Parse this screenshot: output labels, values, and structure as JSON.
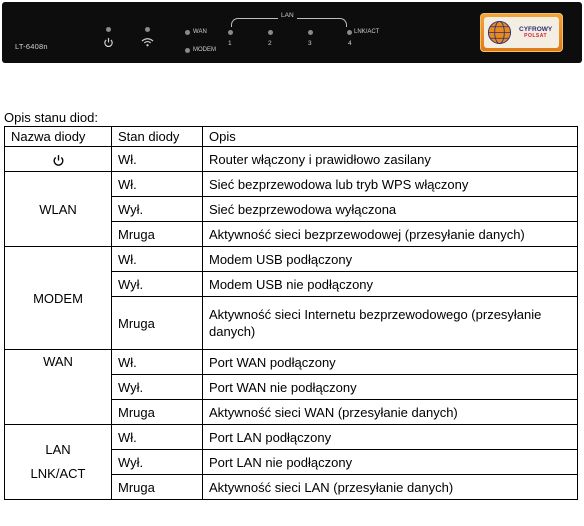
{
  "device": {
    "model": "LT-6408n",
    "labels": {
      "wan": "WAN",
      "modem": "MODEM",
      "lan": "LAN",
      "lnk_act": "LNK/ACT",
      "ports": [
        "1",
        "2",
        "3",
        "4"
      ]
    },
    "icons": [
      "power-icon",
      "wifi-icon"
    ],
    "logo": {
      "line1": "CYFROWY",
      "line2": "POLSAT"
    }
  },
  "caption": "Opis stanu diod:",
  "table": {
    "headers": [
      "Nazwa diody",
      "Stan diody",
      "Opis"
    ],
    "groups": [
      {
        "name": "",
        "name_icon": "power-icon",
        "rows": [
          {
            "state": "Wł.",
            "desc": "Router włączony i prawidłowo zasilany"
          }
        ]
      },
      {
        "name": "WLAN",
        "rows": [
          {
            "state": "Wł.",
            "desc": "Sieć bezprzewodowa lub tryb WPS włączony"
          },
          {
            "state": "Wył.",
            "desc": "Sieć bezprzewodowa wyłączona"
          },
          {
            "state": "Mruga",
            "desc": "Aktywność sieci bezprzewodowej (przesyłanie danych)"
          }
        ]
      },
      {
        "name": "MODEM",
        "rows": [
          {
            "state": "Wł.",
            "desc": "Modem USB podłączony"
          },
          {
            "state": "Wył.",
            "desc": "Modem USB nie podłączony"
          },
          {
            "state": "Mruga",
            "desc": "Aktywność sieci Internetu bezprzewodowego (przesyłanie danych)"
          }
        ]
      },
      {
        "name": "WAN",
        "rows": [
          {
            "state": "Wł.",
            "desc": "Port WAN podłączony"
          },
          {
            "state": "Wył.",
            "desc": "Port WAN nie podłączony"
          },
          {
            "state": "Mruga",
            "desc": "Aktywność sieci WAN (przesyłanie danych)"
          }
        ]
      },
      {
        "name": "LAN",
        "name2": "LNK/ACT",
        "rows": [
          {
            "state": "Wł.",
            "desc": "Port LAN podłączony"
          },
          {
            "state": "Wył.",
            "desc": "Port LAN nie podłączony"
          },
          {
            "state": "Mruga",
            "desc": "Aktywność sieci LAN (przesyłanie danych)"
          }
        ]
      }
    ]
  },
  "colors": {
    "panel": "#0d0d0d",
    "logo_orange": "#e88a1e"
  }
}
